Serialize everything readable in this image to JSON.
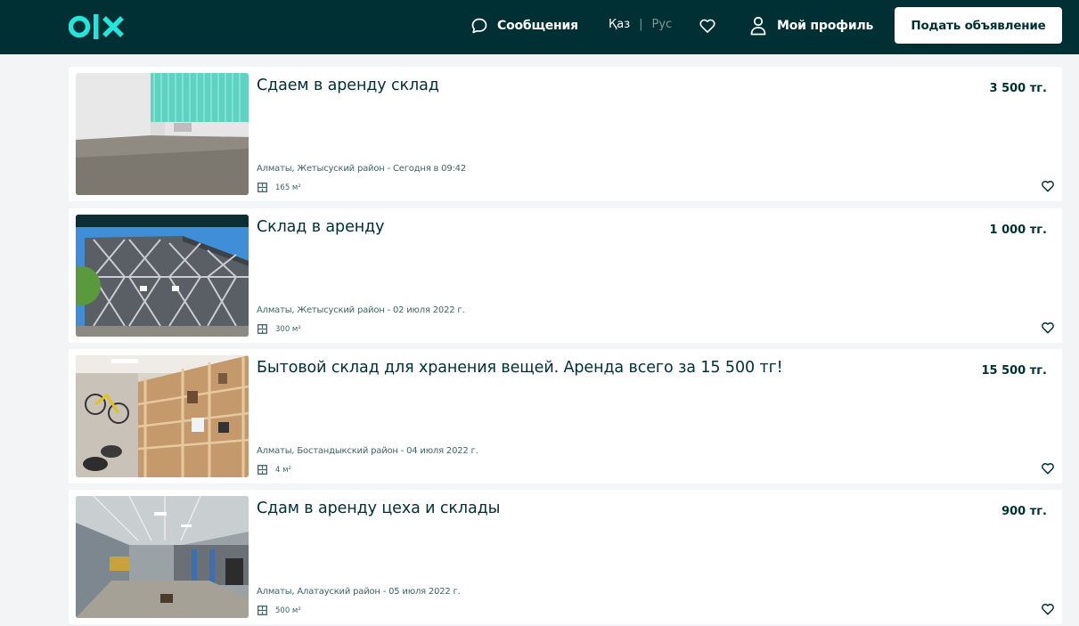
{
  "header": {
    "logo_text": "OLX",
    "messages_label": "Сообщения",
    "lang_kaz": "Қаз",
    "lang_separator": "|",
    "lang_rus": "Рус",
    "profile_label": "Мой профиль",
    "post_ad_label": "Подать объявление",
    "colors": {
      "bar": "#002f34",
      "logo_accent": "#23e5db",
      "text": "#ffffff"
    }
  },
  "listings": [
    {
      "title": "Сдаем в аренду склад",
      "price": "3 500 тг.",
      "location_date": "Алматы, Жетысуский район - Сегодня в 09:42",
      "area": "165 м²",
      "image": "empty-room-teal-curtains"
    },
    {
      "title": "Склад в аренду",
      "price": "1 000 тг.",
      "location_date": "Алматы, Жетысуский район - 02 июля 2022 г.",
      "area": "300 м²",
      "image": "grey-metal-hangar"
    },
    {
      "title": "Бытовой склад для хранения вещей. Аренда всего за 15 500 тг!",
      "price": "15 500 тг.",
      "location_date": "Алматы, Бостандыкский район - 04 июля 2022 г.",
      "area": "4 м²",
      "image": "storage-room-shelves-bicycle"
    },
    {
      "title": "Сдам в аренду цеха и склады",
      "price": "900 тг.",
      "location_date": "Алматы, Алатауский район - 05 июля 2022 г.",
      "area": "500 м²",
      "image": "industrial-workshop-interior"
    }
  ],
  "icons": {
    "messages": "chat-bubble-icon",
    "favorites": "heart-icon",
    "profile": "user-icon",
    "area": "floor-plan-icon"
  },
  "colors": {
    "page_bg": "#f2f4f5",
    "card_bg": "#ffffff",
    "text_primary": "#002f34",
    "text_secondary": "#406367"
  }
}
